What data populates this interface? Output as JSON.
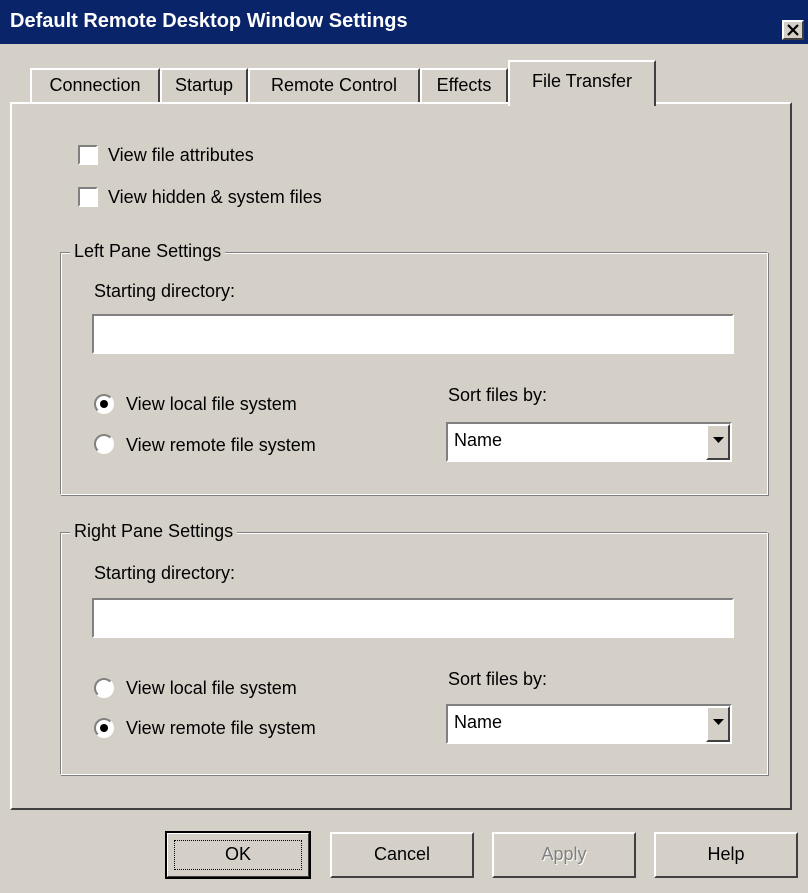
{
  "window": {
    "title": "Default Remote Desktop Window Settings",
    "close_glyph": "close-icon"
  },
  "tabs": [
    {
      "label": "Connection",
      "active": false
    },
    {
      "label": "Startup",
      "active": false
    },
    {
      "label": "Remote Control",
      "active": false
    },
    {
      "label": "Effects",
      "active": false
    },
    {
      "label": "File Transfer",
      "active": true
    }
  ],
  "options": {
    "view_attributes": {
      "label": "View file attributes",
      "checked": false
    },
    "view_hidden": {
      "label": "View hidden & system files",
      "checked": false
    }
  },
  "left_pane": {
    "title": "Left Pane Settings",
    "dir_label": "Starting directory:",
    "dir_value": "",
    "local_label": "View local file system",
    "remote_label": "View remote file system",
    "selected": "local",
    "sort_label": "Sort files by:",
    "sort_value": "Name"
  },
  "right_pane": {
    "title": "Right Pane Settings",
    "dir_label": "Starting directory:",
    "dir_value": "",
    "local_label": "View local file system",
    "remote_label": "View remote file system",
    "selected": "remote",
    "sort_label": "Sort files by:",
    "sort_value": "Name"
  },
  "buttons": {
    "ok": "OK",
    "cancel": "Cancel",
    "apply": "Apply",
    "help": "Help"
  },
  "colors": {
    "titlebar": "#0a246a",
    "face": "#d4d0c8"
  }
}
